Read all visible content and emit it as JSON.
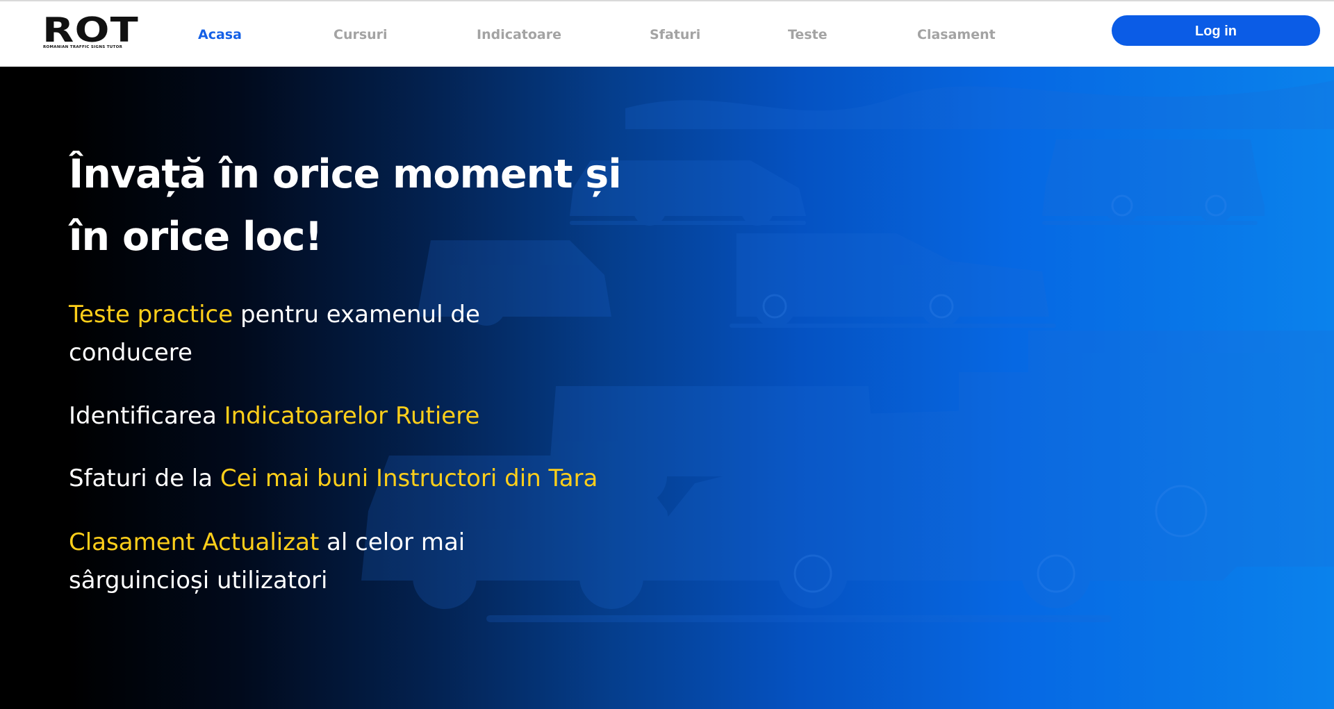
{
  "header": {
    "logo": {
      "main": "ROT",
      "tagline": "ROMANIAN TRAFFIC SIGNS TUTOR"
    },
    "nav": [
      {
        "label": "Acasa",
        "active": true
      },
      {
        "label": "Cursuri",
        "active": false
      },
      {
        "label": "Indicatoare",
        "active": false
      },
      {
        "label": "Sfaturi",
        "active": false
      },
      {
        "label": "Teste",
        "active": false
      },
      {
        "label": "Clasament",
        "active": false
      }
    ],
    "login_label": "Log in"
  },
  "hero": {
    "title_line1": "Învață în orice moment și",
    "title_line2": "în orice loc!",
    "features": [
      {
        "highlight": "Teste practice",
        "text_line1": " pentru examenul de",
        "text_line2": "conducere"
      },
      {
        "text": "Identificarea ",
        "highlight": "Indicatoarelor Rutiere"
      },
      {
        "text": "Sfaturi de la ",
        "highlight": "Cei mai buni Instructori din Tara"
      },
      {
        "highlight": "Clasament Actualizat",
        "text_line1": " al celor mai",
        "text_line2": "sârguincioși utilizatori"
      }
    ]
  },
  "colors": {
    "accent_blue": "#0b5ce6",
    "highlight_yellow": "#ffcf1a",
    "nav_inactive": "#a3a3a3",
    "hero_text": "#ffffff"
  },
  "icons": [
    "car-illustration"
  ]
}
